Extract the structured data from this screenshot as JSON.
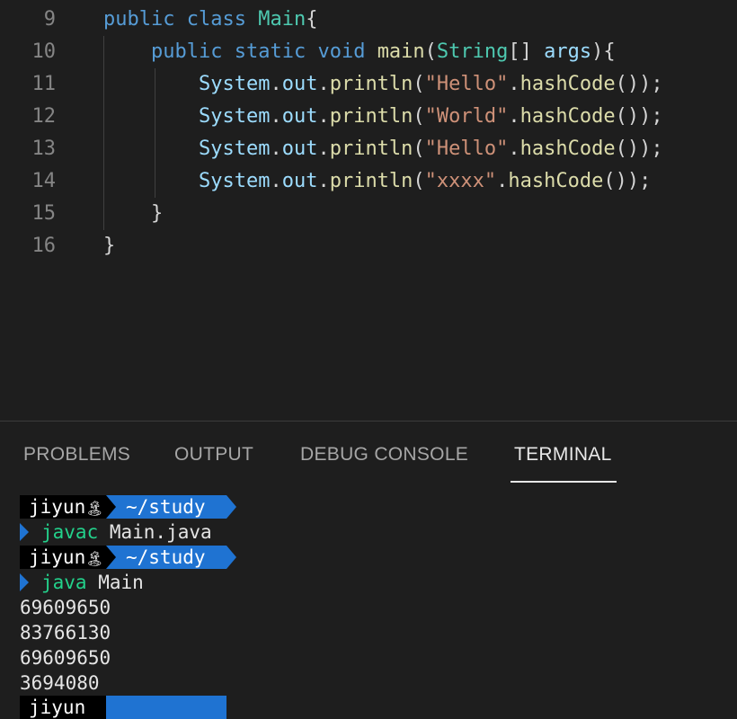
{
  "editor": {
    "lines": [
      {
        "num": "9",
        "parts": [
          [
            "kw",
            "public"
          ],
          [
            "pun",
            " "
          ],
          [
            "kw",
            "class"
          ],
          [
            "pun",
            " "
          ],
          [
            "cls",
            "Main"
          ],
          [
            "pun",
            "{"
          ]
        ]
      },
      {
        "num": "10",
        "parts": [
          [
            "pun",
            "    "
          ],
          [
            "kw",
            "public"
          ],
          [
            "pun",
            " "
          ],
          [
            "kw",
            "static"
          ],
          [
            "pun",
            " "
          ],
          [
            "kw",
            "void"
          ],
          [
            "pun",
            " "
          ],
          [
            "fn",
            "main"
          ],
          [
            "pun",
            "("
          ],
          [
            "cls",
            "String"
          ],
          [
            "pun",
            "[] "
          ],
          [
            "var",
            "args"
          ],
          [
            "pun",
            "){"
          ]
        ]
      },
      {
        "num": "11",
        "parts": [
          [
            "pun",
            "        "
          ],
          [
            "var",
            "System"
          ],
          [
            "pun",
            "."
          ],
          [
            "var",
            "out"
          ],
          [
            "pun",
            "."
          ],
          [
            "fn",
            "println"
          ],
          [
            "pun",
            "("
          ],
          [
            "str",
            "\"Hello\""
          ],
          [
            "pun",
            "."
          ],
          [
            "fn",
            "hashCode"
          ],
          [
            "pun",
            "());"
          ]
        ]
      },
      {
        "num": "12",
        "parts": [
          [
            "pun",
            "        "
          ],
          [
            "var",
            "System"
          ],
          [
            "pun",
            "."
          ],
          [
            "var",
            "out"
          ],
          [
            "pun",
            "."
          ],
          [
            "fn",
            "println"
          ],
          [
            "pun",
            "("
          ],
          [
            "str",
            "\"World\""
          ],
          [
            "pun",
            "."
          ],
          [
            "fn",
            "hashCode"
          ],
          [
            "pun",
            "());"
          ]
        ]
      },
      {
        "num": "13",
        "parts": [
          [
            "pun",
            "        "
          ],
          [
            "var",
            "System"
          ],
          [
            "pun",
            "."
          ],
          [
            "var",
            "out"
          ],
          [
            "pun",
            "."
          ],
          [
            "fn",
            "println"
          ],
          [
            "pun",
            "("
          ],
          [
            "str",
            "\"Hello\""
          ],
          [
            "pun",
            "."
          ],
          [
            "fn",
            "hashCode"
          ],
          [
            "pun",
            "());"
          ]
        ]
      },
      {
        "num": "14",
        "parts": [
          [
            "pun",
            "        "
          ],
          [
            "var",
            "System"
          ],
          [
            "pun",
            "."
          ],
          [
            "var",
            "out"
          ],
          [
            "pun",
            "."
          ],
          [
            "fn",
            "println"
          ],
          [
            "pun",
            "("
          ],
          [
            "str",
            "\"xxxx\""
          ],
          [
            "pun",
            "."
          ],
          [
            "fn",
            "hashCode"
          ],
          [
            "pun",
            "());"
          ]
        ]
      },
      {
        "num": "15",
        "parts": [
          [
            "pun",
            "    }"
          ]
        ]
      },
      {
        "num": "16",
        "parts": [
          [
            "pun",
            "}"
          ]
        ]
      }
    ]
  },
  "panel": {
    "tabs": {
      "problems": "PROBLEMS",
      "output": "OUTPUT",
      "debug_console": "DEBUG CONSOLE",
      "terminal": "TERMINAL"
    },
    "active_tab": "TERMINAL"
  },
  "terminal": {
    "user": "jiyun",
    "user_icon": "🏝",
    "dir": "~/study",
    "cmd1_bin": "javac",
    "cmd1_args": " Main.java",
    "cmd2_bin": "java",
    "cmd2_args": " Main",
    "outputs": [
      "69609650",
      "83766130",
      "69609650",
      "3694080"
    ],
    "partial_prompt_user": "jiyun"
  }
}
